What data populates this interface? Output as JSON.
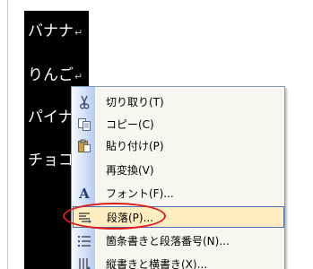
{
  "document": {
    "lines": [
      "バナナ",
      "りんご",
      "パイナ",
      "チョコ"
    ],
    "para_mark": "↵"
  },
  "context_menu": {
    "items": [
      {
        "icon": "scissors-icon",
        "label": "切り取り(T)"
      },
      {
        "icon": "copy-icon",
        "label": "コピー(C)"
      },
      {
        "icon": "paste-icon",
        "label": "貼り付け(P)"
      },
      {
        "icon": "",
        "label": "再変換(V)"
      },
      {
        "icon": "font-icon",
        "label": "フォント(F)..."
      },
      {
        "icon": "paragraph-icon",
        "label": "段落(P)..."
      },
      {
        "icon": "bullets-icon",
        "label": "箇条書きと段落番号(N)..."
      },
      {
        "icon": "text-direction-icon",
        "label": "縦書きと横書き(X)..."
      }
    ],
    "highlighted_item": "段落(P)..."
  },
  "colors": {
    "menu_background": "#f7f6ef",
    "hover_background": "#ffeec2",
    "hover_border": "#4b6fb4",
    "annotation_ellipse": "#e21a1a",
    "selection": "#000000"
  }
}
